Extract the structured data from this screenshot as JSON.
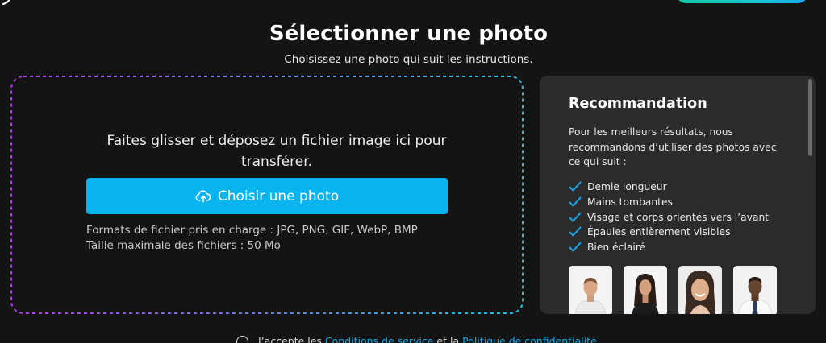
{
  "header": {
    "title": "Sélectionner une photo",
    "subtitle": "Choisissez une photo qui suit les instructions."
  },
  "dropzone": {
    "instruction": "Faites glisser et déposez un fichier image ici pour transférer.",
    "choose_button_label": "Choisir une photo",
    "choose_button_icon": "cloud-upload-icon",
    "formats_text": "Formats de fichier pris en charge : JPG, PNG, GIF, WebP, BMP",
    "max_size_text": "Taille maximale des fichiers : 50 Mo",
    "border_colors": [
      "#b23ae8",
      "#1bc3e0"
    ]
  },
  "recommendation": {
    "title": "Recommandation",
    "description": "Pour les meilleurs résultats, nous recommandons d’utiliser des photos avec ce qui suit :",
    "items": [
      "Demie longueur",
      "Mains tombantes",
      "Visage et corps orientés vers l’avant",
      "Épaules entièrement visibles",
      "Bien éclairé"
    ],
    "check_color": "#13a6e6",
    "example_photos": [
      "man-white-tshirt",
      "woman-black-top",
      "smiling-woman",
      "man-white-shirt-tie"
    ]
  },
  "terms": {
    "prefix": "J’accepte les",
    "tos_link": "Conditions de service",
    "middle": "et la",
    "privacy_link": "Politique de confidentialité"
  },
  "colors": {
    "background": "#141414",
    "accent": "#0ab4ee",
    "panel": "#2b2b2b"
  }
}
